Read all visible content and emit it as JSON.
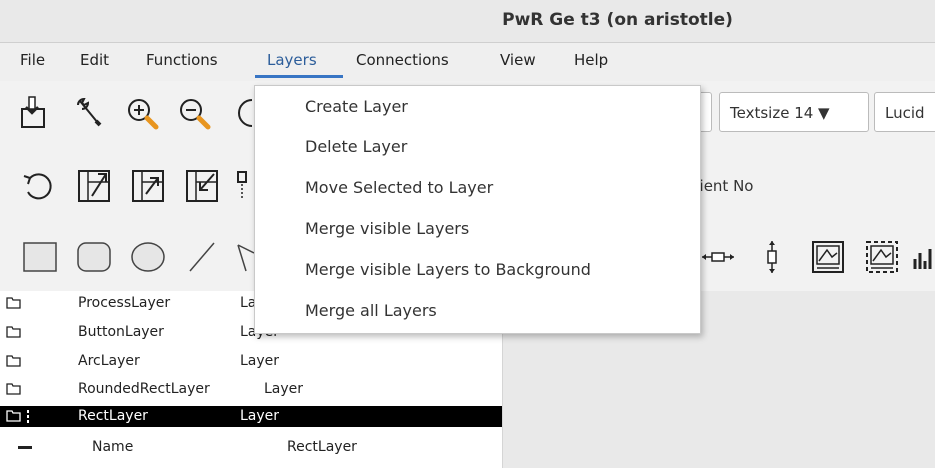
{
  "window": {
    "title": "PwR Ge   t3 (on aristotle)"
  },
  "menubar": {
    "items": [
      {
        "label": "File"
      },
      {
        "label": "Edit"
      },
      {
        "label": "Functions"
      },
      {
        "label": "Layers"
      },
      {
        "label": "Connections"
      },
      {
        "label": "View"
      },
      {
        "label": "Help"
      }
    ],
    "active": "Layers"
  },
  "toolbar": {
    "textsize_label": "Textsize 14",
    "font_label": "Lucid",
    "gradient_label": "dient No"
  },
  "layers_menu": {
    "items": [
      {
        "label": "Create Layer"
      },
      {
        "label": "Delete Layer"
      },
      {
        "label": "Move Selected to Layer"
      },
      {
        "label": "Merge visible Layers"
      },
      {
        "label": "Merge visible Layers to Background"
      },
      {
        "label": "Merge all Layers"
      }
    ]
  },
  "tree": {
    "rows": [
      {
        "name": "ProcessLayer",
        "type": "La"
      },
      {
        "name": "ButtonLayer",
        "type": "Layer"
      },
      {
        "name": "ArcLayer",
        "type": "Layer"
      },
      {
        "name": "RoundedRectLayer",
        "type": "Layer"
      },
      {
        "name": "RectLayer",
        "type": "Layer"
      }
    ],
    "attribute": {
      "name": "Name",
      "value": "RectLayer"
    }
  },
  "colors": {
    "accent": "#3875c4",
    "selected_row": "#000000",
    "canvas_bg": "#e9e9e9"
  }
}
